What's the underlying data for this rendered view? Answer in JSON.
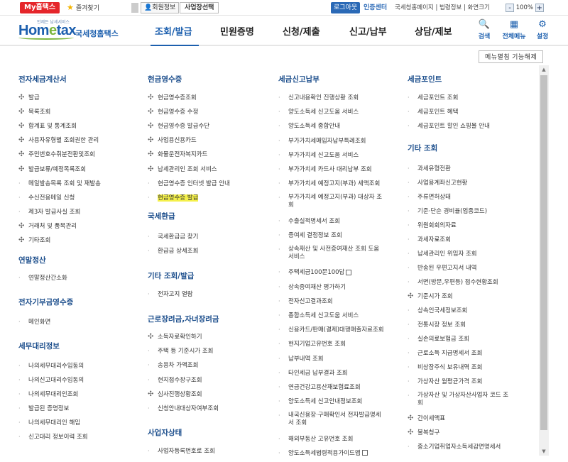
{
  "topbar": {
    "mytax": "My홈택스",
    "favorites": "즐겨찾기",
    "member_info": "회원정보",
    "biz_select": "사업장선택",
    "logout": "로그아웃",
    "cert_center": "인증센터",
    "links": "국세청홈페이지 | 법령정보 | 화면크기",
    "zoom": "100%",
    "zoom_minus": "-",
    "zoom_plus": "+"
  },
  "logo": {
    "tagline": "언제든 납세서비스",
    "word_a": "Hom",
    "word_e": "e",
    "word_b": "tax",
    "kr": "국세청홈택스"
  },
  "gnb": [
    "조회/발급",
    "민원증명",
    "신청/제출",
    "신고/납부",
    "상담/제보"
  ],
  "tools": [
    {
      "icon": "search-icon",
      "label": "검색"
    },
    {
      "icon": "grid-menu-icon",
      "label": "전체메뉴"
    },
    {
      "icon": "gear-icon",
      "label": "설정"
    }
  ],
  "menu_edit": "메뉴펼침 기능해제",
  "columns": [
    {
      "sections": [
        {
          "title": "전자세금계산서",
          "items": [
            {
              "t": "발급",
              "b": "plus"
            },
            {
              "t": "목록조회",
              "b": "plus"
            },
            {
              "t": "합계표 및 통계조회",
              "b": "plus"
            },
            {
              "t": "사용자유형별 조회권한 관리",
              "b": "plus"
            },
            {
              "t": "주민번호수취분전환및조회",
              "b": "plus"
            },
            {
              "t": "발급보류/예정목록조회",
              "b": "plus"
            },
            {
              "t": "메일발송목록 조회 및 재발송",
              "b": "dot"
            },
            {
              "t": "수신전용메일 신청",
              "b": "dot"
            },
            {
              "t": "제3자 발급사실 조회",
              "b": "dot"
            },
            {
              "t": "거래처 및 품목관리",
              "b": "plus"
            },
            {
              "t": "기타조회",
              "b": "plus"
            }
          ]
        },
        {
          "title": "연말정산",
          "items": [
            {
              "t": "연말정산간소화",
              "b": "dot"
            }
          ]
        },
        {
          "title": "전자기부금영수증",
          "items": [
            {
              "t": "메인화면",
              "b": "dot"
            }
          ]
        },
        {
          "title": "세무대리정보",
          "items": [
            {
              "t": "나의세무대리수임동의",
              "b": "dot"
            },
            {
              "t": "나의신고대리수임동의",
              "b": "dot"
            },
            {
              "t": "나의세무대리인조회",
              "b": "dot"
            },
            {
              "t": "발급된 증명정보",
              "b": "dot"
            },
            {
              "t": "나의세무대리인 해임",
              "b": "dot"
            },
            {
              "t": "신고대리 정보이력 조회",
              "b": "dot"
            }
          ]
        }
      ]
    },
    {
      "sections": [
        {
          "title": "현금영수증",
          "items": [
            {
              "t": "현금영수증조회",
              "b": "plus"
            },
            {
              "t": "현금영수증 수정",
              "b": "plus"
            },
            {
              "t": "현금영수증 발급수단",
              "b": "plus"
            },
            {
              "t": "사업용신용카드",
              "b": "plus"
            },
            {
              "t": "화물운전자복지카드",
              "b": "plus"
            },
            {
              "t": "납세관리인 조회 서비스",
              "b": "plus"
            },
            {
              "t": "현금영수증 인터넷 발급 안내",
              "b": "dot"
            },
            {
              "t": "현금영수증 발급",
              "b": "dot",
              "hl": true
            }
          ]
        },
        {
          "title": "국세환급",
          "items": [
            {
              "t": "국세환급금 찾기",
              "b": "dot"
            },
            {
              "t": "환급금 상세조회",
              "b": "dot"
            }
          ]
        },
        {
          "title": "기타 조회/발급",
          "items": [
            {
              "t": "전자고지 열람",
              "b": "dot"
            }
          ]
        },
        {
          "title": "근로장려금,자녀장려금",
          "items": [
            {
              "t": "소득자료확인하기",
              "b": "plus"
            },
            {
              "t": "주택 등 기준시가 조회",
              "b": "dot"
            },
            {
              "t": "송용차 가액조회",
              "b": "dot"
            },
            {
              "t": "현지접수창구조회",
              "b": "dot"
            },
            {
              "t": "심사진행상황조회",
              "b": "plus"
            },
            {
              "t": "신청안내대상자여부조회",
              "b": "dot"
            }
          ]
        },
        {
          "title": "사업자상태",
          "items": [
            {
              "t": "사업자등록번호로 조회",
              "b": "dot"
            }
          ]
        }
      ]
    },
    {
      "sections": [
        {
          "title": "세금신고납부",
          "items": [
            {
              "t": "신고내용확인 진행상황 조회",
              "b": "dot"
            },
            {
              "t": "양도소득세 신고도움 서비스",
              "b": "dot"
            },
            {
              "t": "양도소득세 종합안내",
              "b": "dot"
            },
            {
              "t": "부가가치세매입자납부특례조회",
              "b": "dot"
            },
            {
              "t": "부가가치세 신고도움 서비스",
              "b": "dot"
            },
            {
              "t": "부가가치세 카드사 대리납부 조회",
              "b": "dot"
            },
            {
              "t": "부가가치세 예정고지(부과) 세액조회",
              "b": "dot"
            },
            {
              "t": "부가가치세 예정고지(부과) 대상자 조회",
              "b": "dot",
              "two": true
            },
            {
              "t": "수출실적명세서 조회",
              "b": "dot"
            },
            {
              "t": "증여세 결정정보 조회",
              "b": "dot"
            },
            {
              "t": "상속재산 및 사전증여재산 조회 도움 서비스",
              "b": "dot",
              "two": true
            },
            {
              "t": "주택세금100문100답",
              "b": "dot",
              "ext": true
            },
            {
              "t": "상속증여재산 평가하기",
              "b": "dot"
            },
            {
              "t": "전자신고결과조회",
              "b": "dot"
            },
            {
              "t": "종합소득세 신고도움 서비스",
              "b": "dot"
            },
            {
              "t": "신용카드/판매(결제)대행매출자료조회",
              "b": "dot"
            },
            {
              "t": "현지기업고유번호 조회",
              "b": "dot"
            },
            {
              "t": "납부내역 조회",
              "b": "dot"
            },
            {
              "t": "타인세금 납부결과 조회",
              "b": "dot"
            },
            {
              "t": "연금건강고용산재보험료조회",
              "b": "dot"
            },
            {
              "t": "양도소득세 신고안내정보조회",
              "b": "dot"
            },
            {
              "t": "내국신용장·구매확인서 전자발급명세서 조회",
              "b": "dot",
              "two": true
            },
            {
              "t": "해외부동산 고유번호 조회",
              "b": "dot"
            },
            {
              "t": "양도소득세법령적용가이드맵",
              "b": "dot",
              "ext": true
            }
          ]
        }
      ]
    },
    {
      "sections": [
        {
          "title": "세금포인트",
          "items": [
            {
              "t": "세금포인트 조회",
              "b": "dot"
            },
            {
              "t": "세금포인트 혜택",
              "b": "dot"
            },
            {
              "t": "세금포인트 할인 쇼핑몰 안내",
              "b": "dot"
            }
          ]
        },
        {
          "title": "기타 조회",
          "items": [
            {
              "t": "과세유형전환",
              "b": "dot"
            },
            {
              "t": "사업용계좌신고현황",
              "b": "dot"
            },
            {
              "t": "주류면허상태",
              "b": "dot"
            },
            {
              "t": "기준·단순 경비율(업종코드)",
              "b": "dot"
            },
            {
              "t": "위원회회의자료",
              "b": "dot"
            },
            {
              "t": "과세자료조회",
              "b": "dot"
            },
            {
              "t": "납세관리인 위임자 조회",
              "b": "dot"
            },
            {
              "t": "반송된 우편고지서 내역",
              "b": "dot"
            },
            {
              "t": "서면(방문,우편등) 접수현황조회",
              "b": "dot"
            },
            {
              "t": "기준시가 조회",
              "b": "plus"
            },
            {
              "t": "상속인국세정보조회",
              "b": "dot"
            },
            {
              "t": "전통시장 정보 조회",
              "b": "dot"
            },
            {
              "t": "실손의료보험금 조회",
              "b": "dot"
            },
            {
              "t": "근로소득 지급명세서 조회",
              "b": "dot"
            },
            {
              "t": "비상장주식 보유내역 조회",
              "b": "dot"
            },
            {
              "t": "가상자산 월평균가격 조회",
              "b": "dot"
            },
            {
              "t": "가상자산 및 가상자산사업자 코드 조회",
              "b": "dot",
              "two": true
            },
            {
              "t": "간이세액표",
              "b": "plus"
            },
            {
              "t": "불복청구",
              "b": "plus"
            },
            {
              "t": "중소기업취업자소득세감면명세서",
              "b": "dot"
            }
          ]
        }
      ]
    }
  ]
}
